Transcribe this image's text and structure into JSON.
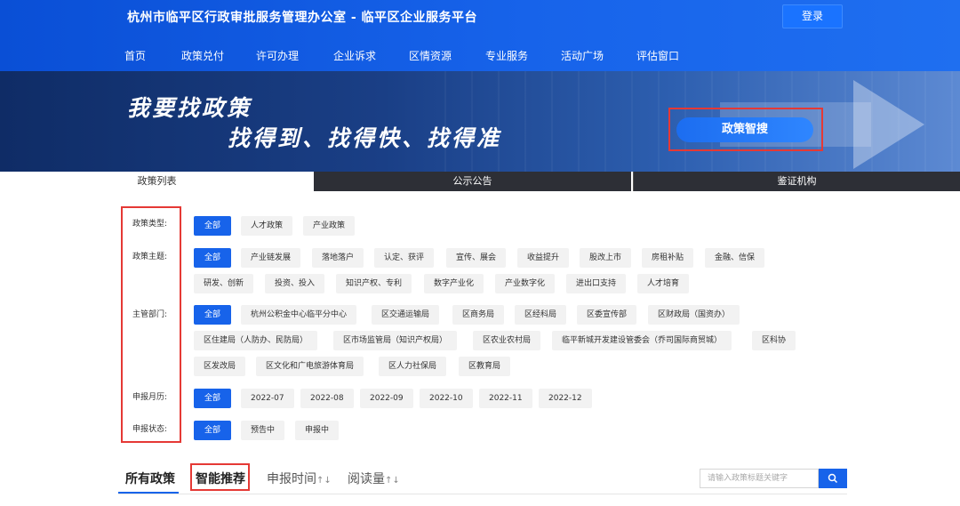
{
  "header": {
    "site_title": "杭州市临平区行政审批服务管理办公室 - 临平区企业服务平台",
    "login_label": "登录",
    "nav": [
      "首页",
      "政策兑付",
      "许可办理",
      "企业诉求",
      "区情资源",
      "专业服务",
      "活动广场",
      "评估窗口"
    ],
    "nav_active": "政策兑付"
  },
  "banner": {
    "slogan_line1": "我要找政策",
    "slogan_line2": "找得到、找得快、找得准",
    "smart_search_label": "政策智搜"
  },
  "tabs": [
    "政策列表",
    "公示公告",
    "鉴证机构"
  ],
  "filters": {
    "policy_type": {
      "label": "政策类型:",
      "options": [
        "全部",
        "人才政策",
        "产业政策"
      ]
    },
    "policy_theme": {
      "label": "政策主题:",
      "options": [
        "全部",
        "产业链发展",
        "落地落户",
        "认定、获评",
        "宣传、展会",
        "收益提升",
        "股改上市",
        "房租补贴",
        "金融、信保",
        "研发、创新",
        "投资、投入",
        "知识产权、专利",
        "数字产业化",
        "产业数字化",
        "进出口支持",
        "人才培育"
      ]
    },
    "department": {
      "label": "主管部门:",
      "options": [
        "全部",
        "杭州公积金中心临平分中心",
        "区交通运输局",
        "区商务局",
        "区经科局",
        "区委宣传部",
        "区财政局（国资办）",
        "区住建局（人防办、民防局）",
        "区市场监管局（知识产权局）",
        "区农业农村局",
        "临平新城开发建设管委会（乔司国际商贸城）",
        "区科协",
        "区发改局",
        "区文化和广电旅游体育局",
        "区人力社保局",
        "区教育局"
      ]
    },
    "apply_month": {
      "label": "申报月历:",
      "options": [
        "全部",
        "2022-07",
        "2022-08",
        "2022-09",
        "2022-10",
        "2022-11",
        "2022-12"
      ]
    },
    "apply_status": {
      "label": "申报状态:",
      "options": [
        "全部",
        "预告中",
        "申报中"
      ]
    }
  },
  "sort": {
    "all_label": "所有政策",
    "smart_label": "智能推荐",
    "time_label": "申报时间",
    "read_label": "阅读量",
    "arrows": "↑↓"
  },
  "search": {
    "placeholder": "请输入政策标题关键字"
  }
}
